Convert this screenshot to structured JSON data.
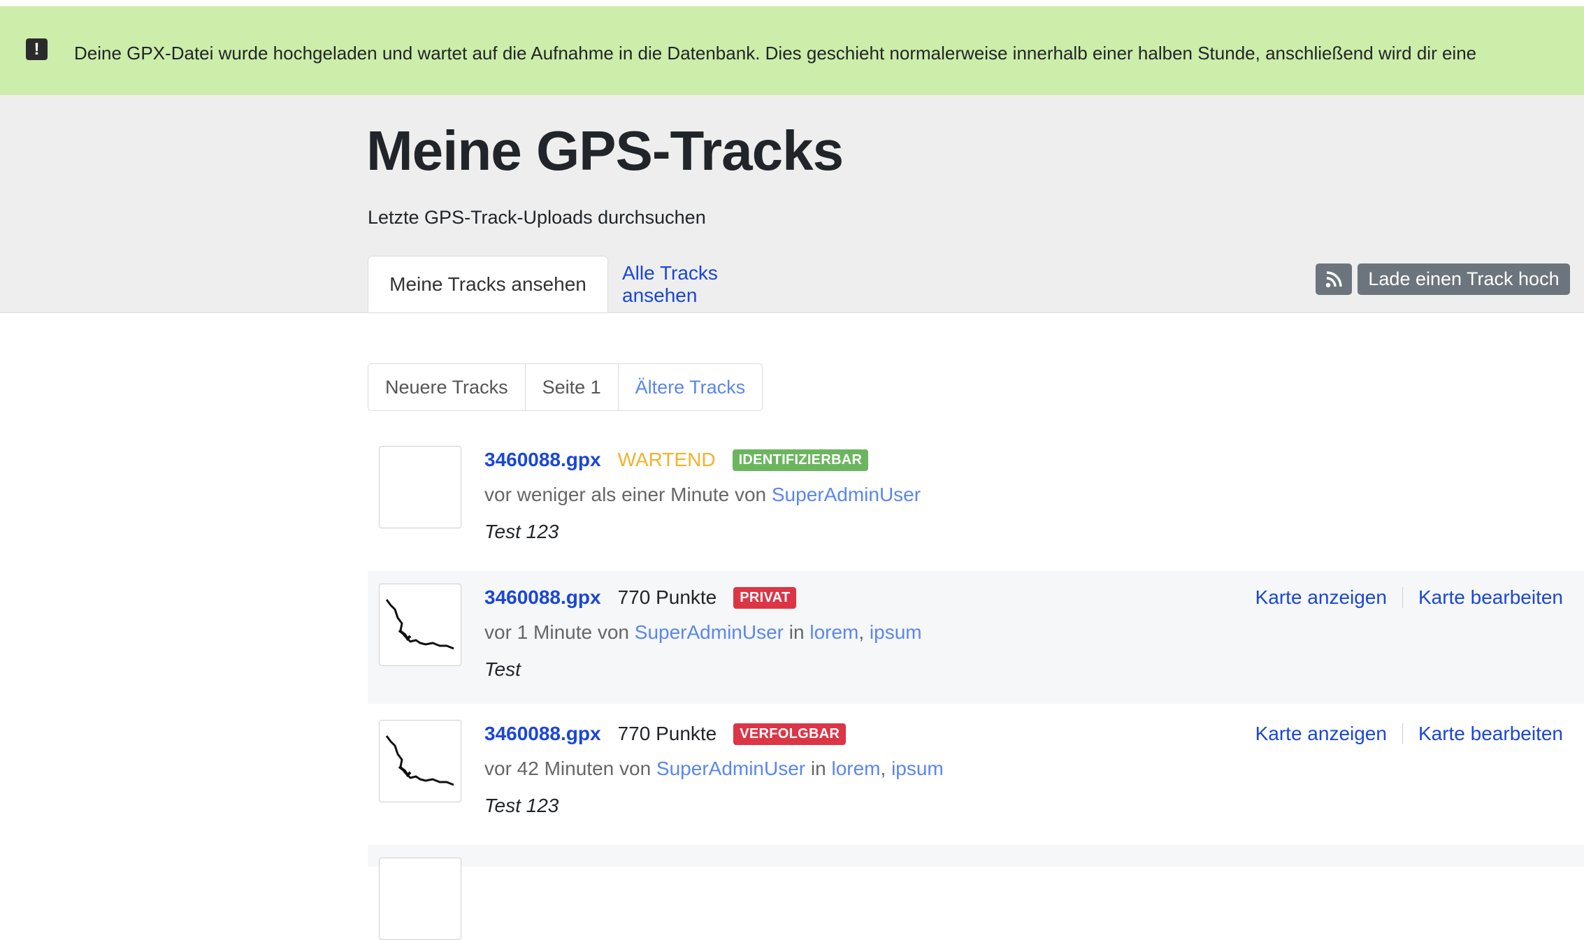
{
  "flash": {
    "icon": "exclamation-icon",
    "message": "Deine GPX-Datei wurde hochgeladen und wartet auf die Aufnahme in die Datenbank. Dies geschieht normalerweise innerhalb einer halben Stunde, anschließend wird dir eine"
  },
  "header": {
    "title": "Meine GPS-Tracks",
    "subtitle": "Letzte GPS-Track-Uploads durchsuchen",
    "tabs": [
      {
        "label": "Meine Tracks ansehen",
        "active": true
      },
      {
        "label": "Alle Tracks ansehen",
        "active": false
      }
    ],
    "rss_icon": "rss-icon",
    "upload_label": "Lade einen Track hoch"
  },
  "pagination": {
    "newer": "Neuere Tracks",
    "page": "Seite 1",
    "older": "Ältere Tracks"
  },
  "tracks": [
    {
      "filename": "3460088.gpx",
      "status": "WARTEND",
      "badge": "IDENTIFIZIERBAR",
      "meta_prefix": "vor weniger als einer Minute von",
      "user": "SuperAdminUser",
      "description": "Test 123"
    },
    {
      "filename": "3460088.gpx",
      "points": "770 Punkte",
      "badge": "PRIVAT",
      "meta_prefix": "vor 1 Minute von",
      "user": "SuperAdminUser",
      "in": "in",
      "tag1": "lorem",
      "comma": ",",
      "tag2": "ipsum",
      "description": "Test",
      "action_view": "Karte anzeigen",
      "action_edit": "Karte bearbeiten"
    },
    {
      "filename": "3460088.gpx",
      "points": "770 Punkte",
      "badge": "VERFOLGBAR",
      "meta_prefix": "vor 42 Minuten von",
      "user": "SuperAdminUser",
      "in": "in",
      "tag1": "lorem",
      "comma": ",",
      "tag2": "ipsum",
      "description": "Test 123",
      "action_view": "Karte anzeigen",
      "action_edit": "Karte bearbeiten"
    }
  ],
  "colors": {
    "flash_bg": "#cdedaa",
    "header_bg": "#eeeeee",
    "link": "#1a46d8",
    "badge_green": "#6cb55f",
    "badge_red": "#dc3545",
    "pending": "#f3b12c"
  }
}
